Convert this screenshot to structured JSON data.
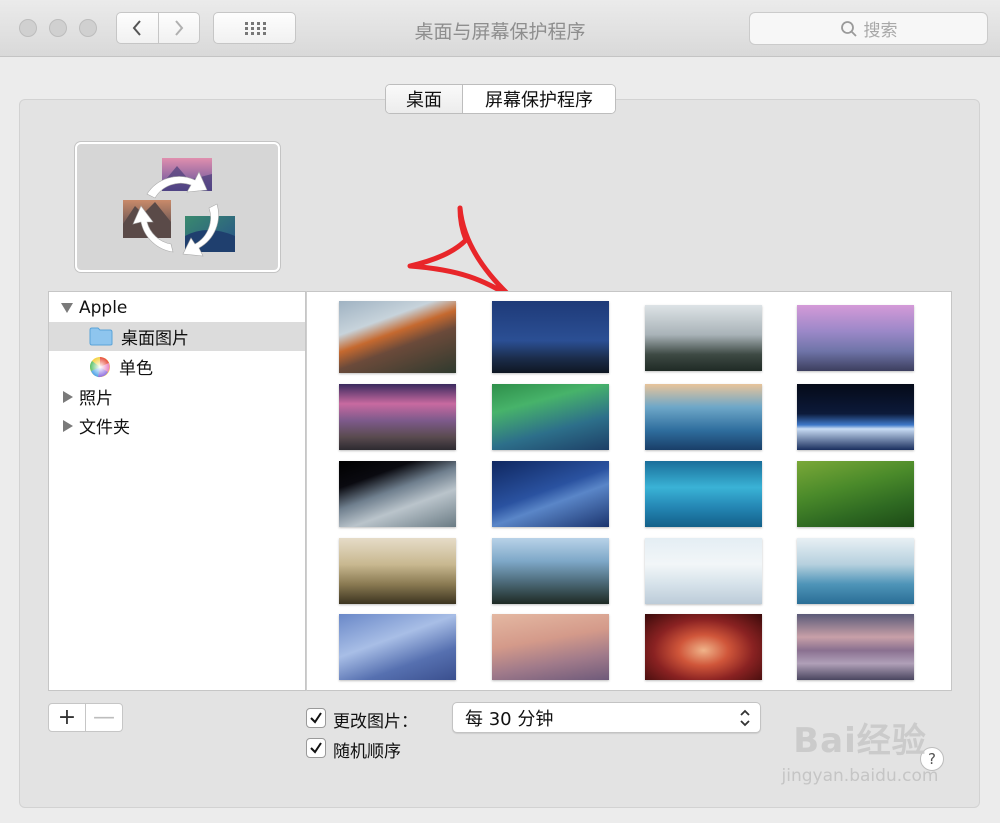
{
  "window": {
    "title": "桌面与屏幕保护程序",
    "search_placeholder": "搜索"
  },
  "tabs": [
    {
      "label": "桌面",
      "selected": false
    },
    {
      "label": "屏幕保护程序",
      "selected": true
    }
  ],
  "sidebar": {
    "items": [
      {
        "label": "Apple",
        "expanded": true
      },
      {
        "label": "桌面图片",
        "selected": true
      },
      {
        "label": "单色"
      },
      {
        "label": "照片",
        "expanded": false
      },
      {
        "label": "文件夹",
        "expanded": false
      }
    ]
  },
  "thumbnails": [
    "el-capitan",
    "yosemite-night",
    "misty-forest",
    "half-dome-pink",
    "lake-sunset",
    "green-wave",
    "blue-wave",
    "earth-horizon",
    "earth-from-space",
    "milky-way",
    "blue-rivers",
    "green-fields",
    "foggy-forest",
    "misty-hills",
    "ice-crack",
    "frozen-trees",
    "glacier",
    "sand-dunes",
    "antelope-canyon",
    "calm-lake"
  ],
  "controls": {
    "add_label": "+",
    "remove_label": "—",
    "change_picture_label": "更改图片：",
    "change_picture_checked": true,
    "interval_value": "每 30 分钟",
    "random_order_label": "随机顺序",
    "random_order_checked": true,
    "help_label": "?"
  },
  "watermark": {
    "brand": "Bai经验",
    "url": "jingyan.baidu.com"
  },
  "colors": {
    "annotation_arrow": "#e8262a"
  }
}
